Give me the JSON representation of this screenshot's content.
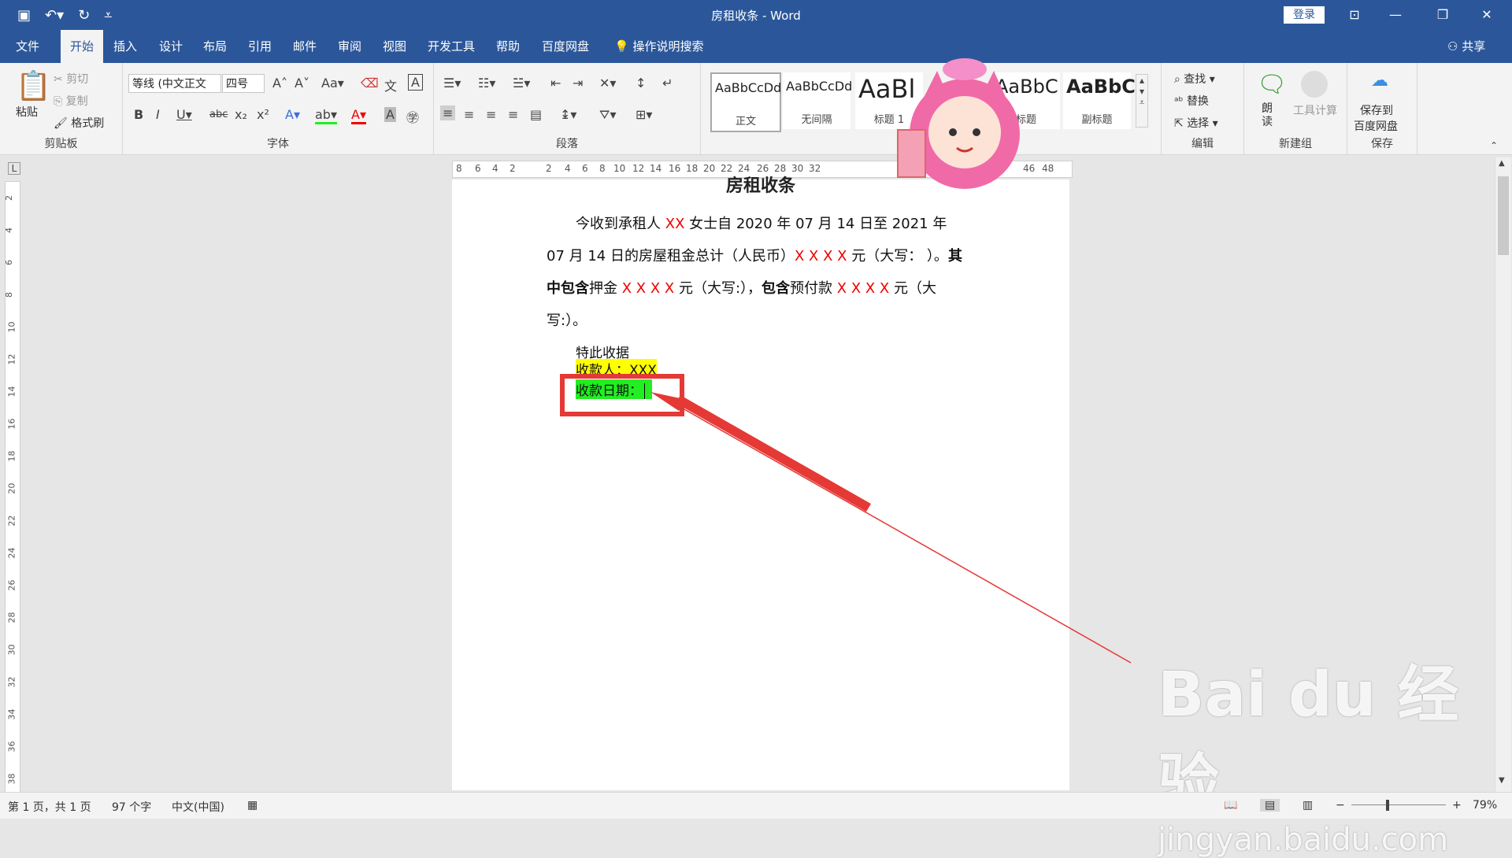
{
  "window": {
    "title": "房租收条 - Word",
    "login": "登录",
    "colors": {
      "accent": "#2b579a",
      "annotation": "#e53935"
    }
  },
  "tabs": [
    "文件",
    "开始",
    "插入",
    "设计",
    "布局",
    "引用",
    "邮件",
    "审阅",
    "视图",
    "开发工具",
    "帮助",
    "百度网盘"
  ],
  "search": "操作说明搜索",
  "share": "共享",
  "ribbon": {
    "clipboard": {
      "label": "剪贴板",
      "paste": "粘贴",
      "cut": "剪切",
      "copy": "复制",
      "format_painter": "格式刷"
    },
    "font": {
      "label": "字体",
      "font_name": "等线 (中文正文",
      "font_size": "四号"
    },
    "paragraph": {
      "label": "段落"
    },
    "styles": [
      {
        "preview": "AaBbCcDd",
        "name": "正文"
      },
      {
        "preview": "AaBbCcDd",
        "name": "无间隔"
      },
      {
        "preview": "AaBl",
        "name": "标题 1"
      },
      {
        "preview": "AaBbC",
        "name": "标题"
      },
      {
        "preview": "AaBbC",
        "name": "副标题"
      }
    ],
    "editing": {
      "label": "编辑",
      "find": "查找",
      "replace": "替换",
      "select": "选择"
    },
    "newgroup": {
      "label": "新建组",
      "read": "朗读",
      "tools": "工具计算"
    },
    "save": {
      "label": "保存",
      "save_to": "保存到",
      "baidu": "百度网盘"
    }
  },
  "ruler": {
    "h_ticks": [
      "8",
      "6",
      "4",
      "2",
      "2",
      "4",
      "6",
      "8",
      "10",
      "12",
      "14",
      "16",
      "18",
      "20",
      "22",
      "24",
      "26",
      "28",
      "30",
      "32",
      "46",
      "48"
    ],
    "v_ticks": [
      "2",
      "4",
      "6",
      "8",
      "10",
      "12",
      "14",
      "16",
      "18",
      "20",
      "22",
      "24",
      "26",
      "28",
      "30",
      "32",
      "34",
      "36",
      "38"
    ]
  },
  "document": {
    "heading": "房租收条",
    "p1_a": "今收到承租人 ",
    "p1_xx": "XX",
    "p1_b": " 女士自 2020 年 07 月 14 日至 2021 年 07 月 14 日的房屋租金总计（人民币）",
    "p1_xxxx1": "X X X X",
    "p1_c": " 元（大写：  ）。",
    "p1_bold1": "其中包含",
    "p1_d": "押金 ",
    "p1_xxxx2": "X X X X",
    "p1_e": " 元（大写:），",
    "p1_bold2": "包含",
    "p1_f": "预付款 ",
    "p1_xxxx3": "X X X X",
    "p1_g": " 元（大写:）。",
    "line_special": "特此收据",
    "line_payee": "收款人：XXX",
    "line_date": "收款日期："
  },
  "status": {
    "page": "第 1 页，共 1 页",
    "words": "97 个字",
    "lang": "中文(中国)",
    "zoom": "79%"
  },
  "watermark": {
    "logo": "Bai du 经验",
    "url": "jingyan.baidu.com"
  }
}
